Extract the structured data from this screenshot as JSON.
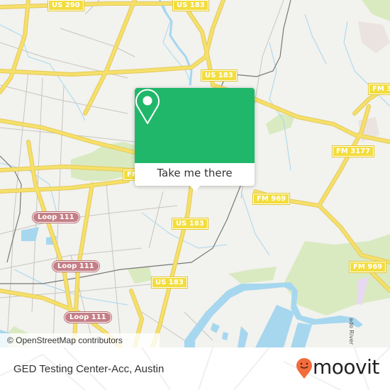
{
  "map": {
    "road_labels": {
      "us290": "US 290",
      "us183_top": "US 183",
      "us183_mid": "US 183",
      "us183_center": "US 183",
      "us183_bottom": "US 183",
      "fm3_topright": "FM 3",
      "fm3177": "FM 3177",
      "fm969_center": "FM 969",
      "fm969_right": "FM 969",
      "fm_left": "FM",
      "loop111_a": "Loop 111",
      "loop111_b": "Loop 111",
      "loop111_c": "Loop 111",
      "loop111_d": "Loop 111"
    },
    "river_label": "ado River",
    "attribution": "© OpenStreetMap contributors",
    "colors": {
      "land": "#f2f2ee",
      "road_major": "#f5e06a",
      "road_minor": "#c9c5c0",
      "water": "#a6d7ef",
      "park": "#d9eac1",
      "rail": "#777777",
      "shield": "#f3dd3d",
      "loop_shield": "#c47f86"
    }
  },
  "popup": {
    "button_label": "Take me there",
    "color": "#21b76a",
    "icon": "map-pin-icon"
  },
  "footer": {
    "place_name": "GED Testing Center-Acc, Austin",
    "brand": "moovit",
    "brand_color": "#f26b3a"
  }
}
